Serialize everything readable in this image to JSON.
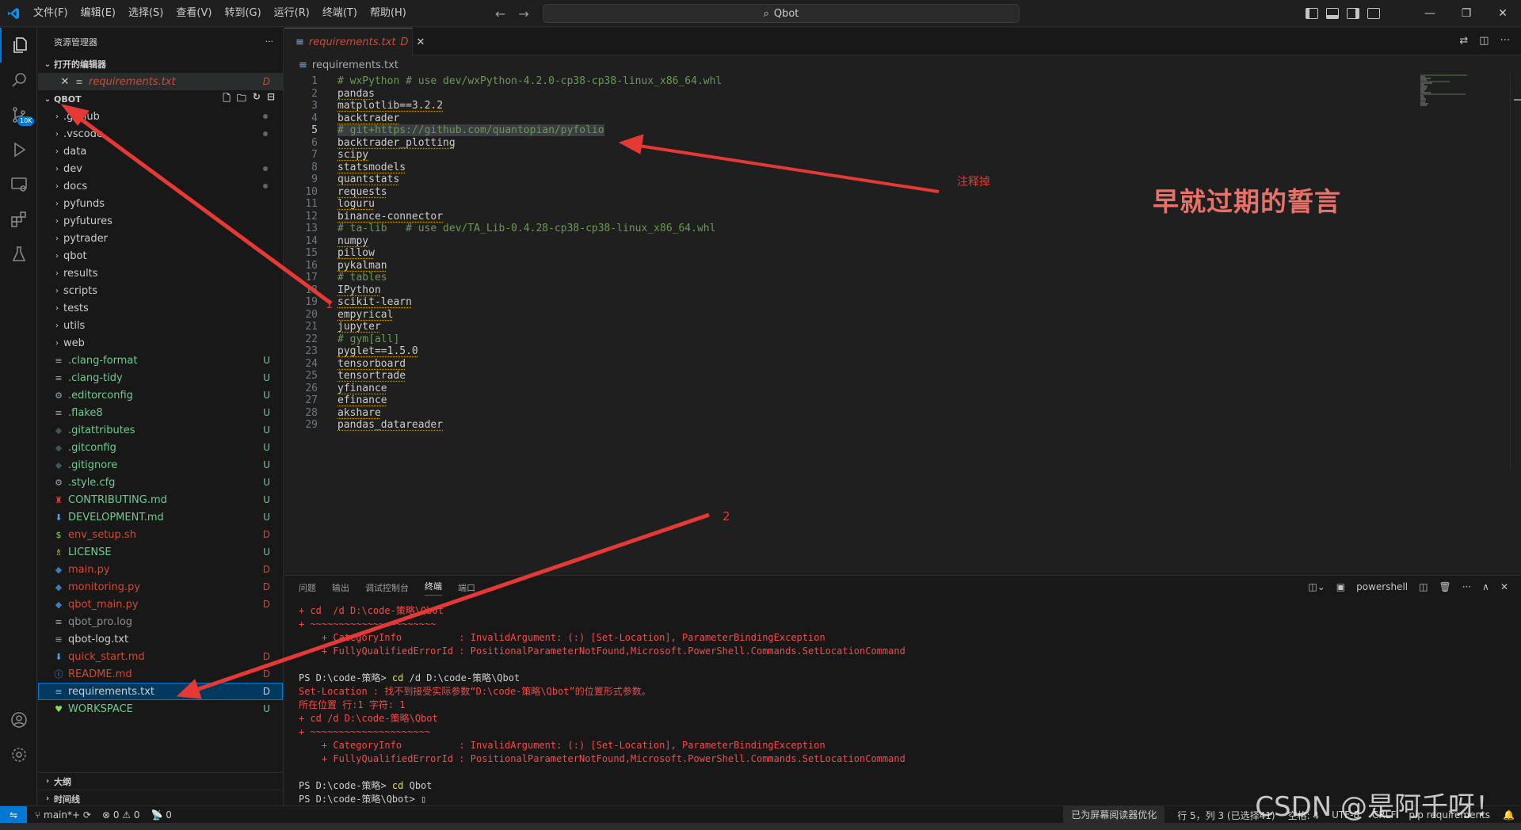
{
  "titlebar": {
    "menu": [
      "文件(F)",
      "编辑(E)",
      "选择(S)",
      "查看(V)",
      "转到(G)",
      "运行(R)",
      "终端(T)",
      "帮助(H)"
    ],
    "search": "Qbot"
  },
  "activity": {
    "scm_badge": "10K"
  },
  "sidebar": {
    "title": "资源管理器",
    "open_editors_label": "打开的编辑器",
    "open_editor": {
      "name": "requirements.txt",
      "status": "D"
    },
    "root": "QBOT",
    "outline": "大纲",
    "timeline": "时间线",
    "items": [
      {
        "name": ".github",
        "type": "folder",
        "status": "dot"
      },
      {
        "name": ".vscode",
        "type": "folder",
        "status": "dot"
      },
      {
        "name": "data",
        "type": "folder",
        "status": ""
      },
      {
        "name": "dev",
        "type": "folder",
        "status": "dot"
      },
      {
        "name": "docs",
        "type": "folder",
        "status": "dot"
      },
      {
        "name": "pyfunds",
        "type": "folder",
        "status": ""
      },
      {
        "name": "pyfutures",
        "type": "folder",
        "status": ""
      },
      {
        "name": "pytrader",
        "type": "folder",
        "status": ""
      },
      {
        "name": "qbot",
        "type": "folder",
        "status": ""
      },
      {
        "name": "results",
        "type": "folder",
        "status": ""
      },
      {
        "name": "scripts",
        "type": "folder",
        "status": ""
      },
      {
        "name": "tests",
        "type": "folder",
        "status": ""
      },
      {
        "name": "utils",
        "type": "folder",
        "status": ""
      },
      {
        "name": "web",
        "type": "folder",
        "status": ""
      },
      {
        "name": ".clang-format",
        "type": "file",
        "icon": "lines",
        "status": "U"
      },
      {
        "name": ".clang-tidy",
        "type": "file",
        "icon": "lines",
        "status": "U"
      },
      {
        "name": ".editorconfig",
        "type": "file",
        "icon": "gear",
        "status": "U"
      },
      {
        "name": ".flake8",
        "type": "file",
        "icon": "lines",
        "status": "U"
      },
      {
        "name": ".gitattributes",
        "type": "file",
        "icon": "git",
        "status": "U"
      },
      {
        "name": ".gitconfig",
        "type": "file",
        "icon": "git",
        "status": "U"
      },
      {
        "name": ".gitignore",
        "type": "file",
        "icon": "git",
        "status": "U"
      },
      {
        "name": ".style.cfg",
        "type": "file",
        "icon": "gear",
        "status": "U"
      },
      {
        "name": "CONTRIBUTING.md",
        "type": "file",
        "icon": "person",
        "status": "U"
      },
      {
        "name": "DEVELOPMENT.md",
        "type": "file",
        "icon": "down",
        "status": "U"
      },
      {
        "name": "env_setup.sh",
        "type": "file",
        "icon": "dollar",
        "status": "D"
      },
      {
        "name": "LICENSE",
        "type": "file",
        "icon": "license",
        "status": "U"
      },
      {
        "name": "main.py",
        "type": "file",
        "icon": "python",
        "status": "D"
      },
      {
        "name": "monitoring.py",
        "type": "file",
        "icon": "python",
        "status": "D"
      },
      {
        "name": "qbot_main.py",
        "type": "file",
        "icon": "python",
        "status": "D"
      },
      {
        "name": "qbot_pro.log",
        "type": "file",
        "icon": "lines",
        "status": ""
      },
      {
        "name": "qbot-log.txt",
        "type": "file",
        "icon": "lines",
        "status": ""
      },
      {
        "name": "quick_start.md",
        "type": "file",
        "icon": "down",
        "status": "D"
      },
      {
        "name": "README.md",
        "type": "file",
        "icon": "info",
        "status": "D"
      },
      {
        "name": "requirements.txt",
        "type": "file",
        "icon": "lines",
        "status": "D",
        "selected": true
      },
      {
        "name": "WORKSPACE",
        "type": "file",
        "icon": "heart",
        "status": "U"
      }
    ]
  },
  "editor": {
    "tab": {
      "name": "requirements.txt",
      "status": "D"
    },
    "breadcrumb": "requirements.txt",
    "current_line": 5,
    "lines": [
      {
        "n": "1",
        "text": "# wxPython # use dev/wxPython-4.2.0-cp38-cp38-linux_x86_64.whl",
        "kind": "comment"
      },
      {
        "n": "2",
        "text": "pandas",
        "kind": "pkg"
      },
      {
        "n": "3",
        "text": "matplotlib==3.2.2",
        "kind": "pkg"
      },
      {
        "n": "4",
        "text": "backtrader",
        "kind": "pkg"
      },
      {
        "n": "5",
        "text": "# git+https://github.com/quantopian/pyfolio",
        "kind": "comment"
      },
      {
        "n": "6",
        "text": "backtrader_plotting",
        "kind": "pkg"
      },
      {
        "n": "7",
        "text": "scipy",
        "kind": "pkg"
      },
      {
        "n": "8",
        "text": "statsmodels",
        "kind": "pkg"
      },
      {
        "n": "9",
        "text": "quantstats",
        "kind": "pkg"
      },
      {
        "n": "10",
        "text": "requests",
        "kind": "pkg"
      },
      {
        "n": "11",
        "text": "loguru",
        "kind": "pkg"
      },
      {
        "n": "12",
        "text": "binance-connector",
        "kind": "pkg"
      },
      {
        "n": "13",
        "text": "# ta-lib   # use dev/TA_Lib-0.4.28-cp38-cp38-linux_x86_64.whl",
        "kind": "comment"
      },
      {
        "n": "14",
        "text": "numpy",
        "kind": "pkg"
      },
      {
        "n": "15",
        "text": "pillow",
        "kind": "pkg"
      },
      {
        "n": "16",
        "text": "pykalman",
        "kind": "pkg"
      },
      {
        "n": "17",
        "text": "# tables",
        "kind": "comment"
      },
      {
        "n": "18",
        "text": "IPython",
        "kind": "pkg"
      },
      {
        "n": "19",
        "text": "scikit-learn",
        "kind": "pkg"
      },
      {
        "n": "20",
        "text": "empyrical",
        "kind": "pkg"
      },
      {
        "n": "21",
        "text": "jupyter",
        "kind": "pkg"
      },
      {
        "n": "22",
        "text": "# gym[all]",
        "kind": "comment"
      },
      {
        "n": "23",
        "text": "pyglet==1.5.0",
        "kind": "pkg"
      },
      {
        "n": "24",
        "text": "tensorboard",
        "kind": "pkg"
      },
      {
        "n": "25",
        "text": "tensortrade",
        "kind": "pkg"
      },
      {
        "n": "26",
        "text": "yfinance",
        "kind": "pkg"
      },
      {
        "n": "27",
        "text": "efinance",
        "kind": "pkg"
      },
      {
        "n": "28",
        "text": "akshare",
        "kind": "pkg"
      },
      {
        "n": "29",
        "text": "pandas_datareader",
        "kind": "pkg"
      }
    ]
  },
  "panel": {
    "tabs": [
      "问题",
      "输出",
      "调试控制台",
      "终端",
      "端口"
    ],
    "active_tab": "终端",
    "shell": "powershell",
    "terminal": [
      {
        "parts": [
          {
            "t": "+ cd  /d D:\\code-策略\\Qbot",
            "c": "r"
          }
        ]
      },
      {
        "parts": [
          {
            "t": "+ ~~~~~~~~~~~~~~~~~~~~~~",
            "c": "r"
          }
        ]
      },
      {
        "parts": [
          {
            "t": "    + CategoryInfo          : InvalidArgument: (:) [Set-Location], ParameterBindingException",
            "c": "r"
          }
        ]
      },
      {
        "parts": [
          {
            "t": "    + FullyQualifiedErrorId : PositionalParameterNotFound,Microsoft.PowerShell.Commands.SetLocationCommand",
            "c": "r"
          }
        ]
      },
      {
        "parts": [
          {
            "t": "",
            "c": "w"
          }
        ]
      },
      {
        "parts": [
          {
            "t": "PS D:\\code-策略> ",
            "c": "w"
          },
          {
            "t": "cd",
            "c": "y"
          },
          {
            "t": " /d D:\\code-策略\\Qbot",
            "c": "w"
          }
        ]
      },
      {
        "parts": [
          {
            "t": "Set-Location : 找不到接受实际参数“D:\\code-策略\\Qbot”的位置形式参数。",
            "c": "r"
          }
        ]
      },
      {
        "parts": [
          {
            "t": "所在位置 行:1 字符: 1",
            "c": "r"
          }
        ]
      },
      {
        "parts": [
          {
            "t": "+ cd /d D:\\code-策略\\Qbot",
            "c": "r"
          }
        ]
      },
      {
        "parts": [
          {
            "t": "+ ~~~~~~~~~~~~~~~~~~~~~",
            "c": "r"
          }
        ]
      },
      {
        "parts": [
          {
            "t": "    + CategoryInfo          : InvalidArgument: (:) [Set-Location], ParameterBindingException",
            "c": "r"
          }
        ]
      },
      {
        "parts": [
          {
            "t": "    + FullyQualifiedErrorId : PositionalParameterNotFound,Microsoft.PowerShell.Commands.SetLocationCommand",
            "c": "r"
          }
        ]
      },
      {
        "parts": [
          {
            "t": "",
            "c": "w"
          }
        ]
      },
      {
        "parts": [
          {
            "t": "PS D:\\code-策略> ",
            "c": "w"
          },
          {
            "t": "cd",
            "c": "y"
          },
          {
            "t": " Qbot",
            "c": "w"
          }
        ]
      },
      {
        "parts": [
          {
            "t": "PS D:\\code-策略\\Qbot> ▯",
            "c": "w"
          }
        ]
      }
    ]
  },
  "statusbar": {
    "branch": "main*+",
    "errors": "0",
    "warnings": "0",
    "ports": "0",
    "screenreader": "已为屏幕阅读器优化",
    "position": "行 5，列 3 (已选择41)",
    "spaces": "空格: 4",
    "encoding": "UTF-8",
    "eol": "CRLF",
    "language": "pip requirements"
  },
  "annotations": {
    "comment_note": "注释掉",
    "big_text": "早就过期的誓言",
    "mark1": "1",
    "mark2": "2"
  },
  "watermark": "CSDN @是阿千呀！",
  "colors": {
    "accent": "#0078d4",
    "annotation": "#e53935",
    "untracked": "#73c991",
    "deleted": "#c74e39",
    "comment": "#6a9955"
  }
}
